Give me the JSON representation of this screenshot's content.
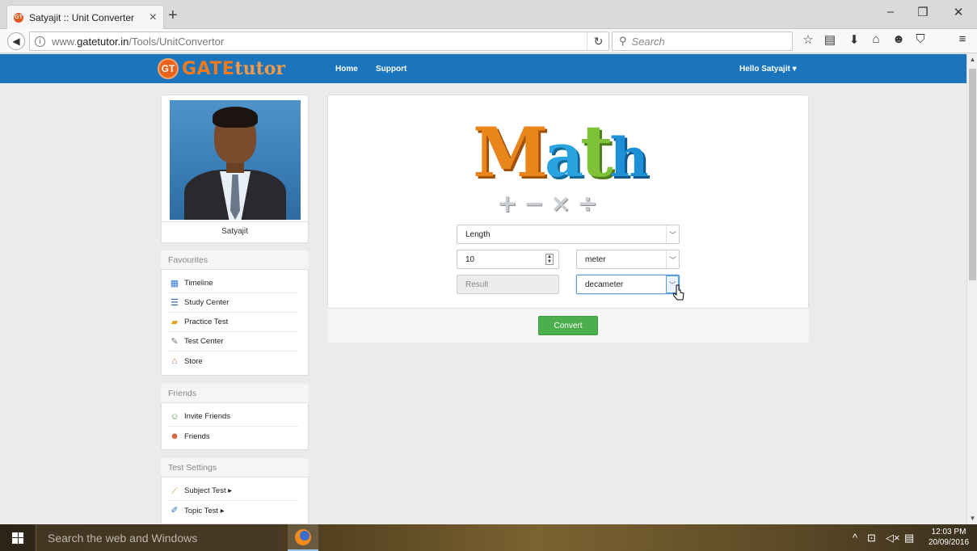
{
  "browser": {
    "tab_title": "Satyajit :: Unit Converter",
    "tab_close": "×",
    "new_tab": "+",
    "url_prefix": "www.",
    "url_domain": "gatetutor.in",
    "url_path": "/Tools/UnitConvertor",
    "search_placeholder": "Search",
    "window_min": "–",
    "window_restore": "❐",
    "window_close": "✕"
  },
  "site": {
    "logo_badge": "GT",
    "logo_gate": "GATE",
    "logo_tutor": "tutor",
    "nav_home": "Home",
    "nav_support": "Support",
    "user_menu": "Hello Satyajit ▾"
  },
  "profile": {
    "name": "Satyajit"
  },
  "favourites": {
    "title": "Favourites",
    "items": [
      {
        "label": "Timeline",
        "icon": "calendar-icon"
      },
      {
        "label": "Study Center",
        "icon": "books-icon"
      },
      {
        "label": "Practice Test",
        "icon": "folder-icon"
      },
      {
        "label": "Test Center",
        "icon": "pen-icon"
      },
      {
        "label": "Store",
        "icon": "store-icon"
      }
    ]
  },
  "friends": {
    "title": "Friends",
    "items": [
      {
        "label": "Invite Friends",
        "icon": "invite-icon"
      },
      {
        "label": "Friends",
        "icon": "friends-icon"
      }
    ]
  },
  "test_settings": {
    "title": "Test Settings",
    "items": [
      {
        "label": "Subject Test ▸",
        "icon": "ruler-icon"
      },
      {
        "label": "Topic Test ▸",
        "icon": "edit-icon"
      }
    ]
  },
  "converter": {
    "logo_letters": [
      "M",
      "a",
      "t",
      "h"
    ],
    "logo_ops": "+−×÷",
    "category": "Length",
    "input_value": "10",
    "from_unit": "meter",
    "result_placeholder": "Result",
    "to_unit": "decameter",
    "convert_label": "Convert"
  },
  "taskbar": {
    "search_placeholder": "Search the web and Windows",
    "time": "12:03 PM",
    "date": "20/09/2016"
  },
  "colors": {
    "header_blue": "#1a75bd",
    "convert_green": "#4cae4c",
    "logo_orange": "#f07a1e"
  }
}
